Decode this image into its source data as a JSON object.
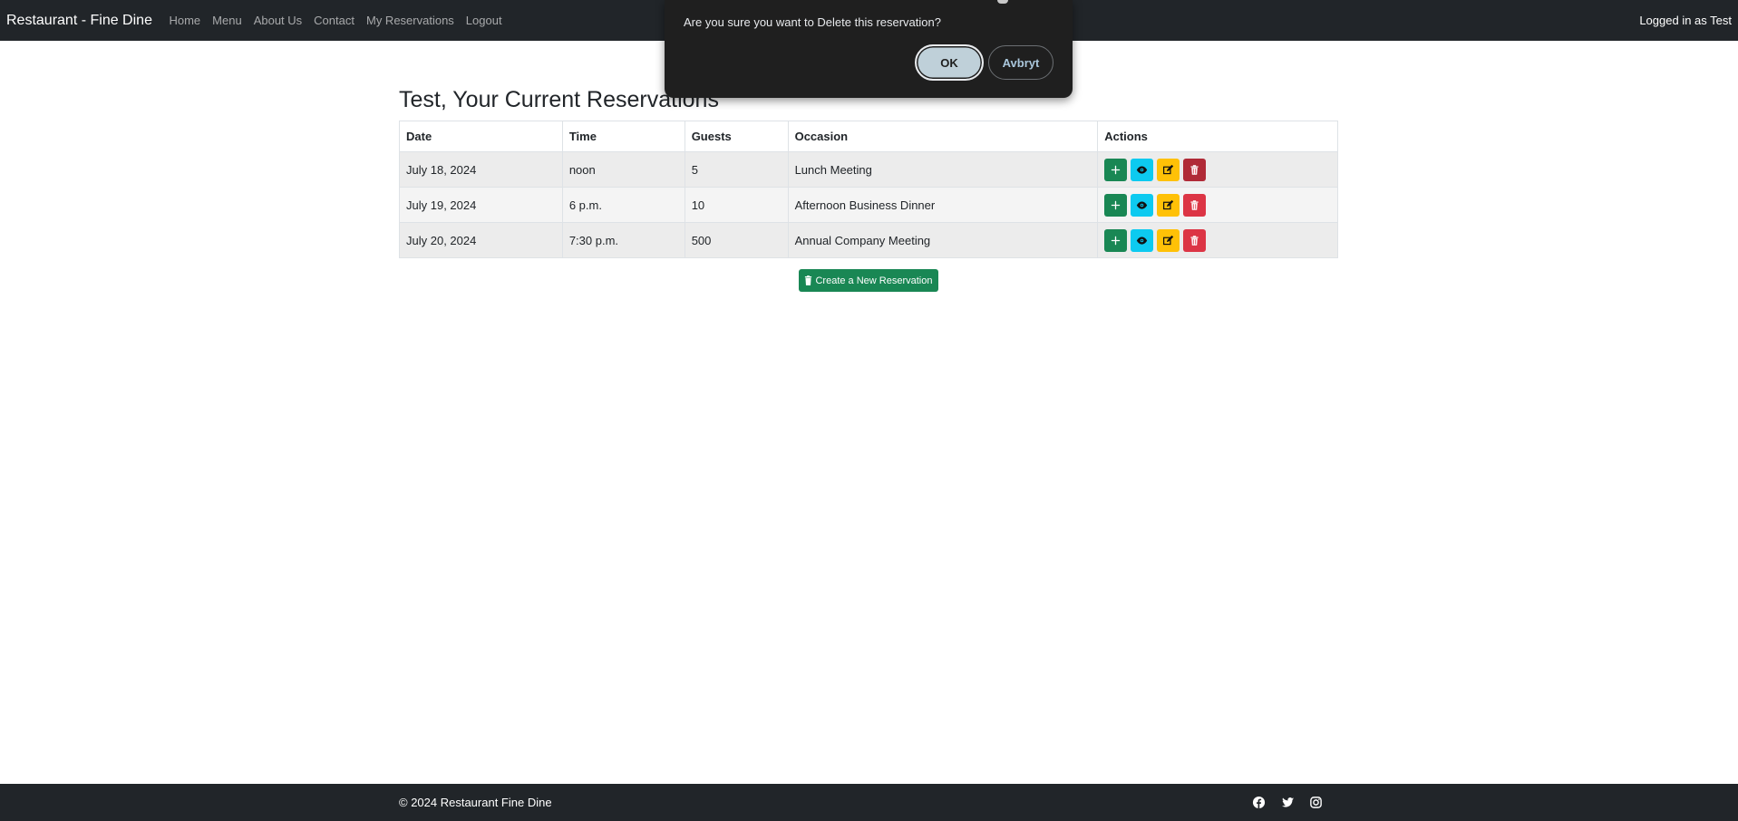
{
  "navbar": {
    "brand": "Restaurant - Fine Dine",
    "links": [
      "Home",
      "Menu",
      "About Us",
      "Contact",
      "My Reservations",
      "Logout"
    ],
    "logged_in": "Logged in as Test"
  },
  "main": {
    "heading": "Test, Your Current Reservations",
    "table": {
      "headers": [
        "Date",
        "Time",
        "Guests",
        "Occasion",
        "Actions"
      ],
      "rows": [
        [
          "July 18, 2024",
          "noon",
          "5",
          "Lunch Meeting"
        ],
        [
          "July 19, 2024",
          "6 p.m.",
          "10",
          "Afternoon Business Dinner"
        ],
        [
          "July 20, 2024",
          "7:30 p.m.",
          "500",
          "Annual Company Meeting"
        ]
      ],
      "action_icons": [
        "plus-icon",
        "eye-icon",
        "edit-icon",
        "trash-icon"
      ]
    },
    "create_button": "Create a New Reservation"
  },
  "footer": {
    "copyright": "© 2024 Restaurant Fine Dine",
    "social_icons": [
      "facebook-icon",
      "twitter-icon",
      "instagram-icon"
    ]
  },
  "dialog": {
    "message": "Are you sure you want to Delete this reservation?",
    "ok_label": "OK",
    "cancel_label": "Avbryt"
  },
  "colors": {
    "navbar_bg": "#212529",
    "success": "#198754",
    "info": "#0dcaf0",
    "warning": "#ffc107",
    "danger": "#dc3545",
    "dialog_bg": "#1f1f1f"
  }
}
